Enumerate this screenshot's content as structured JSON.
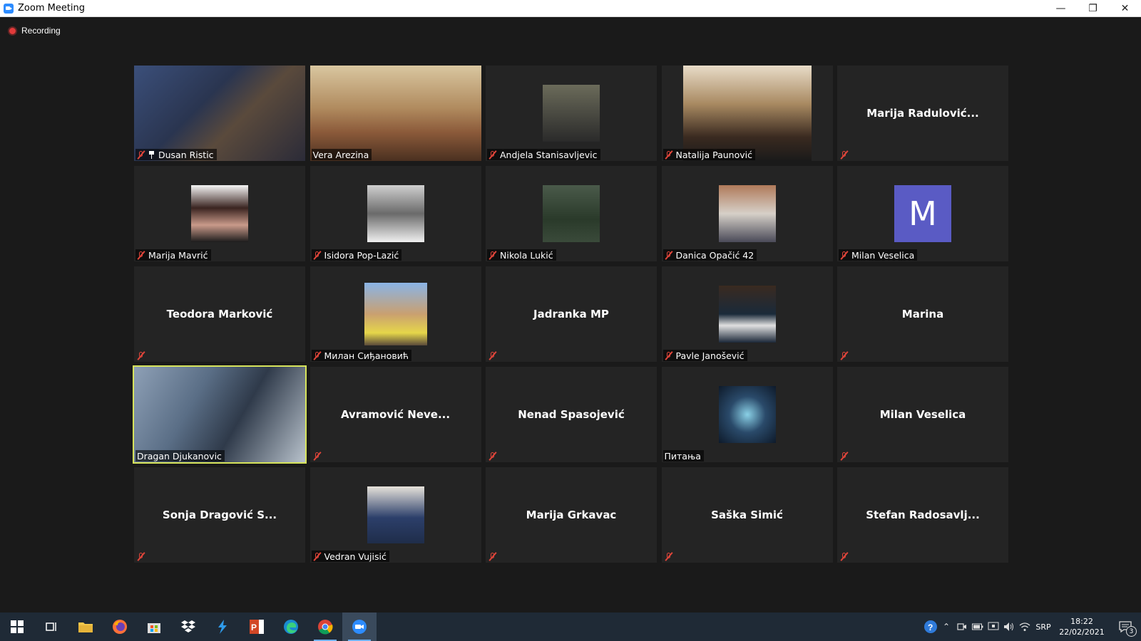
{
  "window": {
    "title": "Zoom Meeting"
  },
  "recording": {
    "label": "Recording"
  },
  "tiles": [
    {
      "name": "Dusan Ristic",
      "type": "video",
      "muted": true,
      "pinned": true
    },
    {
      "name": "Vera Arezina",
      "type": "video",
      "muted": false
    },
    {
      "name": "Andjela Stanisavljevic",
      "type": "photo",
      "muted": true
    },
    {
      "name": "Natalija Paunović",
      "type": "video",
      "muted": true
    },
    {
      "name": "Marija  Radulović...",
      "type": "text",
      "muted": true
    },
    {
      "name": "Marija Mavrić",
      "type": "photo",
      "muted": true
    },
    {
      "name": "Isidora Pop-Lazić",
      "type": "photo",
      "muted": true
    },
    {
      "name": "Nikola Lukić",
      "type": "photo",
      "muted": true
    },
    {
      "name": "Danica Opačić 42",
      "type": "photo",
      "muted": true
    },
    {
      "name": "Milan Veselica",
      "type": "avatar",
      "initial": "M",
      "muted": true
    },
    {
      "name": "Teodora Marković",
      "type": "text",
      "muted": true
    },
    {
      "name": "Милан Сиђановић",
      "type": "photo",
      "muted": true
    },
    {
      "name": "Jadranka MP",
      "type": "text",
      "muted": true
    },
    {
      "name": "Pavle Janošević",
      "type": "photo",
      "muted": true
    },
    {
      "name": "Marina",
      "type": "text",
      "muted": true
    },
    {
      "name": "Dragan Djukanovic",
      "type": "video",
      "muted": false,
      "active_speaker": true
    },
    {
      "name": "Avramović  Neve...",
      "type": "text",
      "muted": true
    },
    {
      "name": "Nenad Spasojević",
      "type": "text",
      "muted": true
    },
    {
      "name": "Питања",
      "type": "photo",
      "muted": false
    },
    {
      "name": "Milan Veselica",
      "type": "text",
      "muted": true
    },
    {
      "name": "Sonja  Dragović  S...",
      "type": "text",
      "muted": true
    },
    {
      "name": "Vedran Vujisić",
      "type": "photo",
      "muted": true
    },
    {
      "name": "Marija Grkavac",
      "type": "text",
      "muted": true
    },
    {
      "name": "Saška Simić",
      "type": "text",
      "muted": true
    },
    {
      "name": "Stefan  Radosavlj...",
      "type": "text",
      "muted": true
    }
  ],
  "taskbar": {
    "apps": [
      "start-icon",
      "task-view-icon",
      "file-explorer-icon",
      "firefox-icon",
      "store-icon",
      "dropbox-icon",
      "visual-studio-icon",
      "powerpoint-icon",
      "edge-icon",
      "chrome-icon",
      "zoom-icon"
    ],
    "lang": "SRP",
    "time": "18:22",
    "date": "22/02/2021",
    "notifications": "3"
  },
  "colors": {
    "accent_speaker": "#d6e35a",
    "mute_red": "#e0453a",
    "zoom_blue": "#2D8CFF",
    "avatar_bg": "#5a5bc4"
  }
}
